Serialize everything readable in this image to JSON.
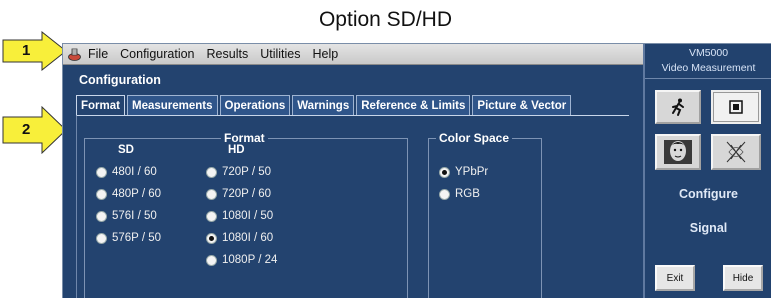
{
  "doc_title": "Option SD/HD",
  "callouts": [
    {
      "number": "1"
    },
    {
      "number": "2"
    }
  ],
  "colors": {
    "callout_fill": "#f8ef3a",
    "window_bg": "#23436f",
    "menubar_bg": "#d4d4d4"
  },
  "menubar": {
    "app_icon": "scope-app-icon",
    "items": [
      "File",
      "Configuration",
      "Results",
      "Utilities",
      "Help"
    ]
  },
  "side_panel": {
    "brand_line1": "VM5000",
    "brand_line2": "Video Measurement",
    "icons": [
      "running-figure-icon",
      "stop-square-icon",
      "face-picture-icon",
      "vector-scope-icon"
    ],
    "label_configure": "Configure",
    "label_signal": "Signal",
    "exit_label": "Exit",
    "hide_label": "Hide"
  },
  "main": {
    "section_title": "Configuration",
    "tabs": [
      {
        "label": "Format",
        "active": true
      },
      {
        "label": "Measurements",
        "active": false
      },
      {
        "label": "Operations",
        "active": false
      },
      {
        "label": "Warnings",
        "active": false
      },
      {
        "label": "Reference & Limits",
        "active": false
      },
      {
        "label": "Picture & Vector",
        "active": false
      }
    ],
    "format_group": {
      "legend": "Format",
      "sd_header": "SD",
      "hd_header": "HD",
      "sd_options": [
        {
          "label": "480I / 60",
          "checked": false
        },
        {
          "label": "480P / 60",
          "checked": false
        },
        {
          "label": "576I / 50",
          "checked": false
        },
        {
          "label": "576P / 50",
          "checked": false
        }
      ],
      "hd_options": [
        {
          "label": "720P / 50",
          "checked": false
        },
        {
          "label": "720P / 60",
          "checked": false
        },
        {
          "label": "1080I / 50",
          "checked": false
        },
        {
          "label": "1080I / 60",
          "checked": true
        },
        {
          "label": "1080P / 24",
          "checked": false
        }
      ]
    },
    "color_space_group": {
      "legend": "Color Space",
      "options": [
        {
          "label": "YPbPr",
          "checked": true
        },
        {
          "label": "RGB",
          "checked": false
        }
      ]
    }
  }
}
